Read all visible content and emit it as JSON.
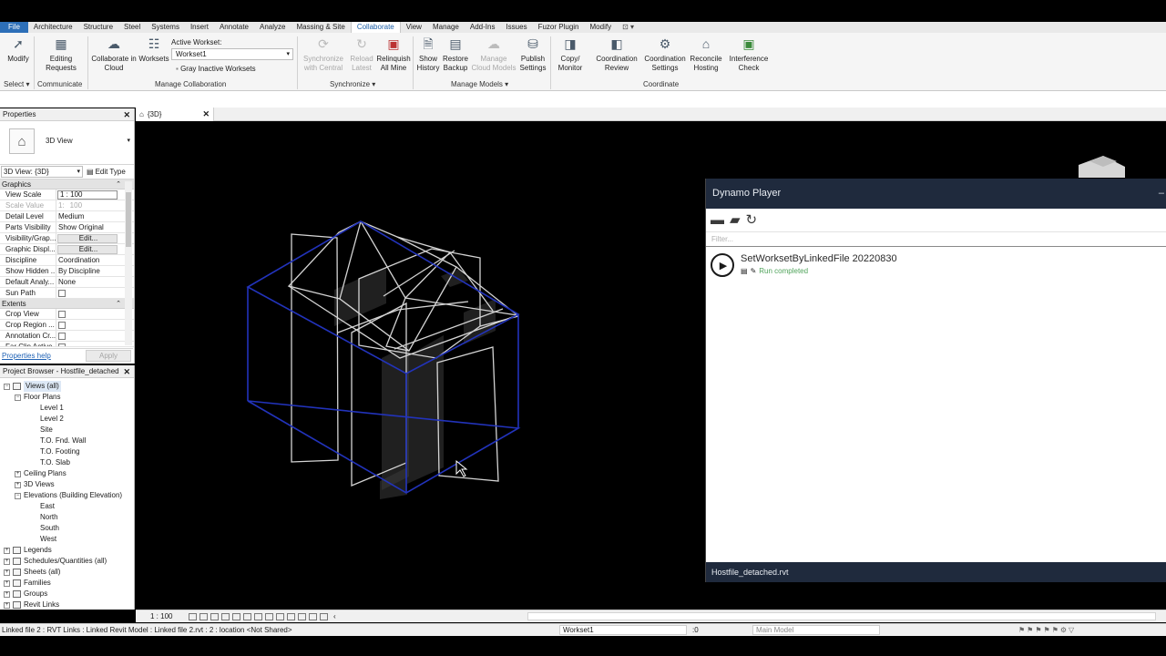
{
  "menu": {
    "tabs": [
      "File",
      "Architecture",
      "Structure",
      "Steel",
      "Systems",
      "Insert",
      "Annotate",
      "Analyze",
      "Massing & Site",
      "Collaborate",
      "View",
      "Manage",
      "Add-Ins",
      "Issues",
      "Fuzor Plugin",
      "Modify"
    ],
    "active": "Collaborate"
  },
  "ribbon": {
    "modify": "Modify",
    "editing_requests": [
      "Editing",
      "Requests"
    ],
    "collab_cloud": [
      "Collaborate in",
      "Cloud"
    ],
    "worksets": "Worksets",
    "active_workset_label": "Active Workset:",
    "active_workset_value": "Workset1",
    "gray_inactive": "Gray Inactive Worksets",
    "sync_central": [
      "Synchronize",
      "with Central"
    ],
    "reload_latest": [
      "Reload",
      "Latest"
    ],
    "relinquish": [
      "Relinquish",
      "All Mine"
    ],
    "show_history": [
      "Show",
      "History"
    ],
    "restore_backup": [
      "Restore",
      "Backup"
    ],
    "manage_cloud": [
      "Manage",
      "Cloud Models"
    ],
    "publish_settings": [
      "Publish",
      "Settings"
    ],
    "copy_monitor": [
      "Copy/",
      "Monitor"
    ],
    "coord_review": [
      "Coordination",
      "Review"
    ],
    "coord_settings": [
      "Coordination",
      "Settings"
    ],
    "reconcile": [
      "Reconcile",
      "Hosting"
    ],
    "interference": [
      "Interference",
      "Check"
    ],
    "panels": {
      "select": "Select",
      "communicate": "Communicate",
      "manage_collab": "Manage Collaboration",
      "synchronize": "Synchronize",
      "manage_models": "Manage Models",
      "coordinate": "Coordinate"
    }
  },
  "properties": {
    "title": "Properties",
    "type_name": "3D View",
    "view_selector": "3D View: {3D}",
    "edit_type": "Edit Type",
    "groups": {
      "graphics": "Graphics",
      "extents": "Extents"
    },
    "rows": [
      {
        "k": "View Scale",
        "v": "1 : 100"
      },
      {
        "k": "Scale Value",
        "v": "100"
      },
      {
        "k": "Detail Level",
        "v": "Medium"
      },
      {
        "k": "Parts Visibility",
        "v": "Show Original"
      },
      {
        "k": "Visibility/Grap...",
        "v": "Edit..."
      },
      {
        "k": "Graphic Displ...",
        "v": "Edit..."
      },
      {
        "k": "Discipline",
        "v": "Coordination"
      },
      {
        "k": "Show Hidden ...",
        "v": "By Discipline"
      },
      {
        "k": "Default Analy...",
        "v": "None"
      },
      {
        "k": "Sun Path",
        "v": ""
      }
    ],
    "extent_rows": [
      "Crop View",
      "Crop Region ...",
      "Annotation Cr...",
      "Far Clip Active"
    ],
    "scale_value_prefix": "1:",
    "help": "Properties help",
    "apply": "Apply"
  },
  "browser": {
    "title": "Project Browser - Hostfile_detached",
    "nodes": [
      {
        "label": "Views (all)",
        "level": 1
      },
      {
        "label": "Floor Plans",
        "level": 2
      },
      {
        "label": "Level 1",
        "level": 3
      },
      {
        "label": "Level 2",
        "level": 3
      },
      {
        "label": "Site",
        "level": 3
      },
      {
        "label": "T.O. Fnd. Wall",
        "level": 3
      },
      {
        "label": "T.O. Footing",
        "level": 3
      },
      {
        "label": "T.O. Slab",
        "level": 3
      },
      {
        "label": "Ceiling Plans",
        "level": 2
      },
      {
        "label": "3D Views",
        "level": 2
      },
      {
        "label": "Elevations (Building Elevation)",
        "level": 2
      },
      {
        "label": "East",
        "level": 3
      },
      {
        "label": "North",
        "level": 3
      },
      {
        "label": "South",
        "level": 3
      },
      {
        "label": "West",
        "level": 3
      },
      {
        "label": "Legends",
        "level": 1
      },
      {
        "label": "Schedules/Quantities (all)",
        "level": 1
      },
      {
        "label": "Sheets (all)",
        "level": 1
      },
      {
        "label": "Families",
        "level": 1
      },
      {
        "label": "Groups",
        "level": 1
      },
      {
        "label": "Revit Links",
        "level": 1
      }
    ]
  },
  "view_tab": {
    "label": "{3D}"
  },
  "dynamo": {
    "title": "Dynamo Player",
    "filter_placeholder": "Filter...",
    "script_name": "SetWorksetByLinkedFile 20220830",
    "status": "Run completed",
    "footer": "Hostfile_detached.rvt"
  },
  "view_control": {
    "scale": "1 : 100"
  },
  "statusbar": {
    "text": "Linked file 2 : RVT Links : Linked Revit Model : Linked file 2.rvt : 2 : location <Not Shared>",
    "workset": "Workset1",
    "count": ":0",
    "design_option": "Main Model"
  },
  "colors": {
    "accent": "#2d6fb8",
    "dynamo_header": "#1f2a3d",
    "status_ok": "#4fa35a",
    "model_blue": "#2233bb"
  }
}
